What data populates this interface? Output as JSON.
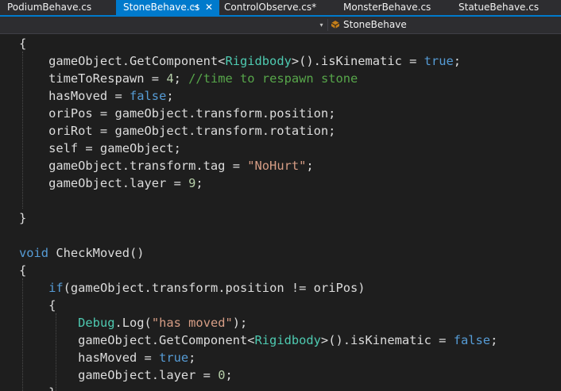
{
  "tabs": [
    {
      "label": "PodiumBehave.cs",
      "active": false
    },
    {
      "label": "StoneBehave.cs",
      "active": true,
      "pin": "⊣",
      "close": "✕"
    },
    {
      "label": "ControlObserve.cs*",
      "active": false
    },
    {
      "label": "MonsterBehave.cs",
      "active": false
    },
    {
      "label": "StatueBehave.cs",
      "active": false
    }
  ],
  "navbar": {
    "dropdown_icon": "▾",
    "member_icon": "class-member-icon",
    "member_label": "StoneBehave"
  },
  "colors": {
    "accent": "#007acc",
    "background": "#1e1e1e",
    "keyword": "#569cd6",
    "type": "#4ec9b0",
    "string": "#d69d85",
    "number": "#b5cea8",
    "comment": "#57a64a",
    "text": "#dcdcdc"
  },
  "code": {
    "lines": [
      [
        {
          "t": "{"
        }
      ],
      [
        {
          "t": "    gameObject.GetComponent<"
        },
        {
          "t": "Rigidbody",
          "c": "ty"
        },
        {
          "t": ">().isKinematic = "
        },
        {
          "t": "true",
          "c": "kw"
        },
        {
          "t": ";"
        }
      ],
      [
        {
          "t": "    timeToRespawn = "
        },
        {
          "t": "4",
          "c": "num"
        },
        {
          "t": "; "
        },
        {
          "t": "//time to respawn stone",
          "c": "cm"
        }
      ],
      [
        {
          "t": "    hasMoved = "
        },
        {
          "t": "false",
          "c": "kw"
        },
        {
          "t": ";"
        }
      ],
      [
        {
          "t": "    oriPos = gameObject.transform.position;"
        }
      ],
      [
        {
          "t": "    oriRot = gameObject.transform.rotation;"
        }
      ],
      [
        {
          "t": "    self = gameObject;"
        }
      ],
      [
        {
          "t": "    gameObject.transform.tag = "
        },
        {
          "t": "\"NoHurt\"",
          "c": "str"
        },
        {
          "t": ";"
        }
      ],
      [
        {
          "t": "    gameObject.layer = "
        },
        {
          "t": "9",
          "c": "num"
        },
        {
          "t": ";"
        }
      ],
      [],
      [
        {
          "t": "}"
        }
      ],
      [],
      [
        {
          "t": "void",
          "c": "kw"
        },
        {
          "t": " CheckMoved()"
        }
      ],
      [
        {
          "t": "{"
        }
      ],
      [
        {
          "t": "    "
        },
        {
          "t": "if",
          "c": "kw"
        },
        {
          "t": "(gameObject.transform.position != oriPos)"
        }
      ],
      [
        {
          "t": "    {"
        }
      ],
      [
        {
          "t": "        "
        },
        {
          "t": "Debug",
          "c": "ty"
        },
        {
          "t": ".Log("
        },
        {
          "t": "\"has moved\"",
          "c": "str"
        },
        {
          "t": ");"
        }
      ],
      [
        {
          "t": "        gameObject.GetComponent<"
        },
        {
          "t": "Rigidbody",
          "c": "ty"
        },
        {
          "t": ">().isKinematic = "
        },
        {
          "t": "false",
          "c": "kw"
        },
        {
          "t": ";"
        }
      ],
      [
        {
          "t": "        hasMoved = "
        },
        {
          "t": "true",
          "c": "kw"
        },
        {
          "t": ";"
        }
      ],
      [
        {
          "t": "        gameObject.layer = "
        },
        {
          "t": "0",
          "c": "num"
        },
        {
          "t": ";"
        }
      ],
      [
        {
          "t": "    }"
        }
      ]
    ]
  }
}
